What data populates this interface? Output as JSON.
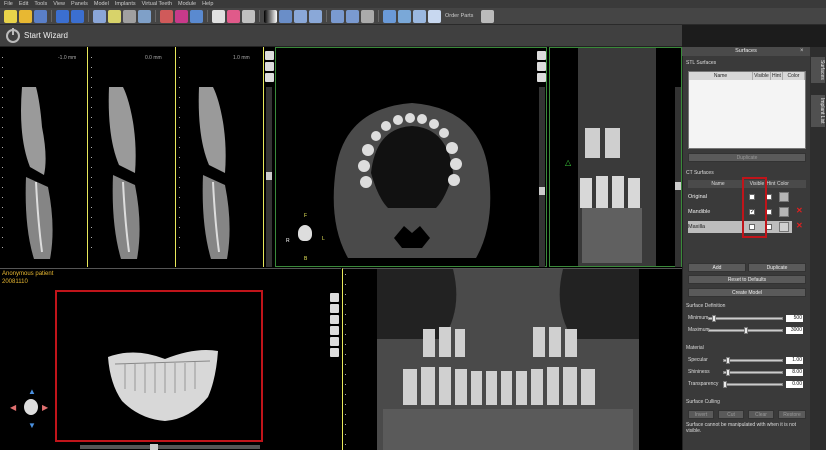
{
  "menu": [
    "File",
    "Edit",
    "Tools",
    "View",
    "Panels",
    "Model",
    "Implants",
    "Virtual Teeth",
    "Module",
    "Help"
  ],
  "toolbar": {
    "order_parts_label": "Order Parts"
  },
  "wizard": {
    "label": "Start Wizard"
  },
  "cross_sections": [
    {
      "label": "-1.0 mm",
      "color": "#e8e85a"
    },
    {
      "label": "0.0 mm",
      "color": "#e8e85a"
    },
    {
      "label": "1.0 mm",
      "color": "#e8e85a"
    }
  ],
  "axial_view": {
    "letters": [
      "F",
      "R",
      "L",
      "B"
    ]
  },
  "volume_view": {
    "patient_name": "Anonymous patient",
    "patient_date": "20081110"
  },
  "panel": {
    "title": "Surfaces",
    "stl_section_title": "STL Surfaces",
    "stl_columns": [
      "Name",
      "Visible",
      "Hint",
      "Color"
    ],
    "duplicate_label": "Duplicate",
    "ct_section_title": "CT Surfaces",
    "ct_columns": [
      "Name",
      "Visible",
      "Hint",
      "Color"
    ],
    "ct_rows": [
      {
        "name": "Original",
        "visible": false
      },
      {
        "name": "Mandible",
        "visible": true
      },
      {
        "name": "Maxilla",
        "visible": false
      }
    ],
    "add_label": "Add",
    "duplicate2_label": "Duplicate",
    "reset_label": "Reset to Defaults",
    "create_label": "Create Model",
    "surface_def_title": "Surface Definition",
    "minimum_label": "Minimum",
    "minimum_value": "500",
    "maximum_label": "Maximum",
    "maximum_value": "3000",
    "material_title": "Material",
    "specular_label": "Specular",
    "specular_value": "1.00",
    "shininess_label": "Shininess",
    "shininess_value": "8.00",
    "transparency_label": "Transparency",
    "transparency_value": "0.00",
    "culling_title": "Surface Culling",
    "culling_buttons": [
      "Invert",
      "Cut",
      "Clear",
      "Restore"
    ],
    "culling_note": "Surface cannot be manipulated with when it is not visible."
  },
  "right_tabs": [
    "Surfaces",
    "Implant List"
  ]
}
